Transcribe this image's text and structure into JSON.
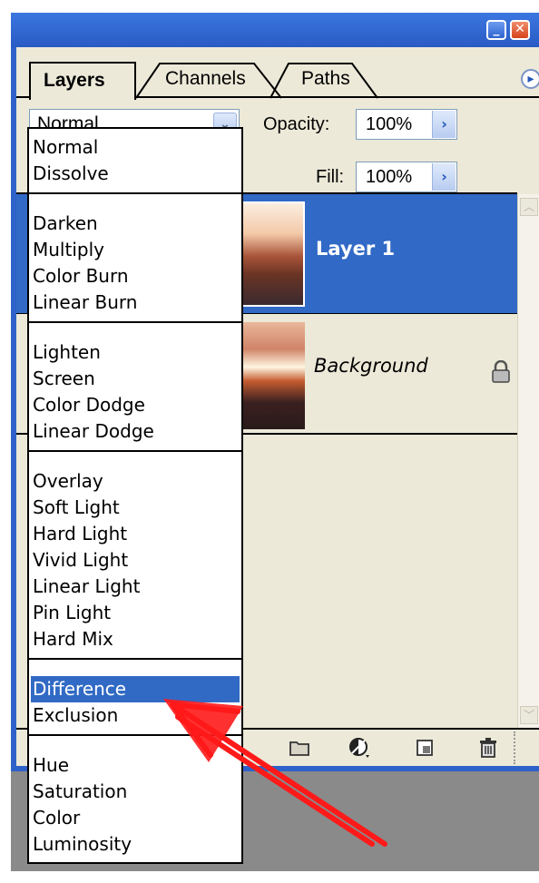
{
  "tabs": [
    "Layers",
    "Channels",
    "Paths"
  ],
  "blend_mode": {
    "selected": "Normal"
  },
  "opacity": {
    "label": "Opacity:",
    "value": "100%"
  },
  "fill": {
    "label": "Fill:",
    "value": "100%"
  },
  "layers": [
    {
      "name": "Layer 1",
      "selected": true
    },
    {
      "name": "Background",
      "locked": true
    }
  ],
  "dropdown": {
    "groups": [
      [
        "Normal",
        "Dissolve"
      ],
      [
        "Darken",
        "Multiply",
        "Color Burn",
        "Linear Burn"
      ],
      [
        "Lighten",
        "Screen",
        "Color Dodge",
        "Linear Dodge"
      ],
      [
        "Overlay",
        "Soft Light",
        "Hard Light",
        "Vivid Light",
        "Linear Light",
        "Pin Light",
        "Hard Mix"
      ],
      [
        "Difference",
        "Exclusion"
      ],
      [
        "Hue",
        "Saturation",
        "Color",
        "Luminosity"
      ]
    ],
    "highlighted": "Difference"
  },
  "icons": {
    "minimize": "minimize-icon",
    "close": "close-icon",
    "panel_menu": "panel-menu-icon",
    "lock": "lock-icon",
    "folder": "new-group-folder-icon",
    "adjustment": "adjustment-layer-icon",
    "new_layer": "new-layer-icon",
    "trash": "trash-icon",
    "annotation_arrow": "red-arrow-icon"
  },
  "colors": {
    "selection": "#316ac5",
    "layer_selected": "#3169c6",
    "panel_bg": "#ece9d8",
    "arrow": "#ff1a1a"
  }
}
